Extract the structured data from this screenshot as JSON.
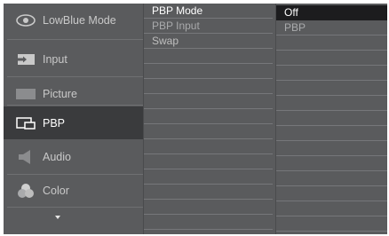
{
  "sidebar": {
    "items": [
      {
        "label": "LowBlue Mode",
        "icon": "eye-icon"
      },
      {
        "label": "Input",
        "icon": "input-arrow-icon"
      },
      {
        "label": "Picture",
        "icon": "picture-icon"
      },
      {
        "label": "PBP",
        "icon": "pbp-icon",
        "selected": true
      },
      {
        "label": "Audio",
        "icon": "speaker-icon"
      },
      {
        "label": "Color",
        "icon": "color-circles-icon"
      }
    ],
    "more_icon": "chevron-down-icon"
  },
  "submenu": {
    "items": [
      "PBP Mode",
      "PBP Input",
      "Swap"
    ]
  },
  "options": {
    "items": [
      "Off",
      "PBP"
    ]
  },
  "colors": {
    "panel": "#5a5b5d",
    "selected_bg": "#3a3b3d",
    "highlight": "#1c1c1e"
  }
}
